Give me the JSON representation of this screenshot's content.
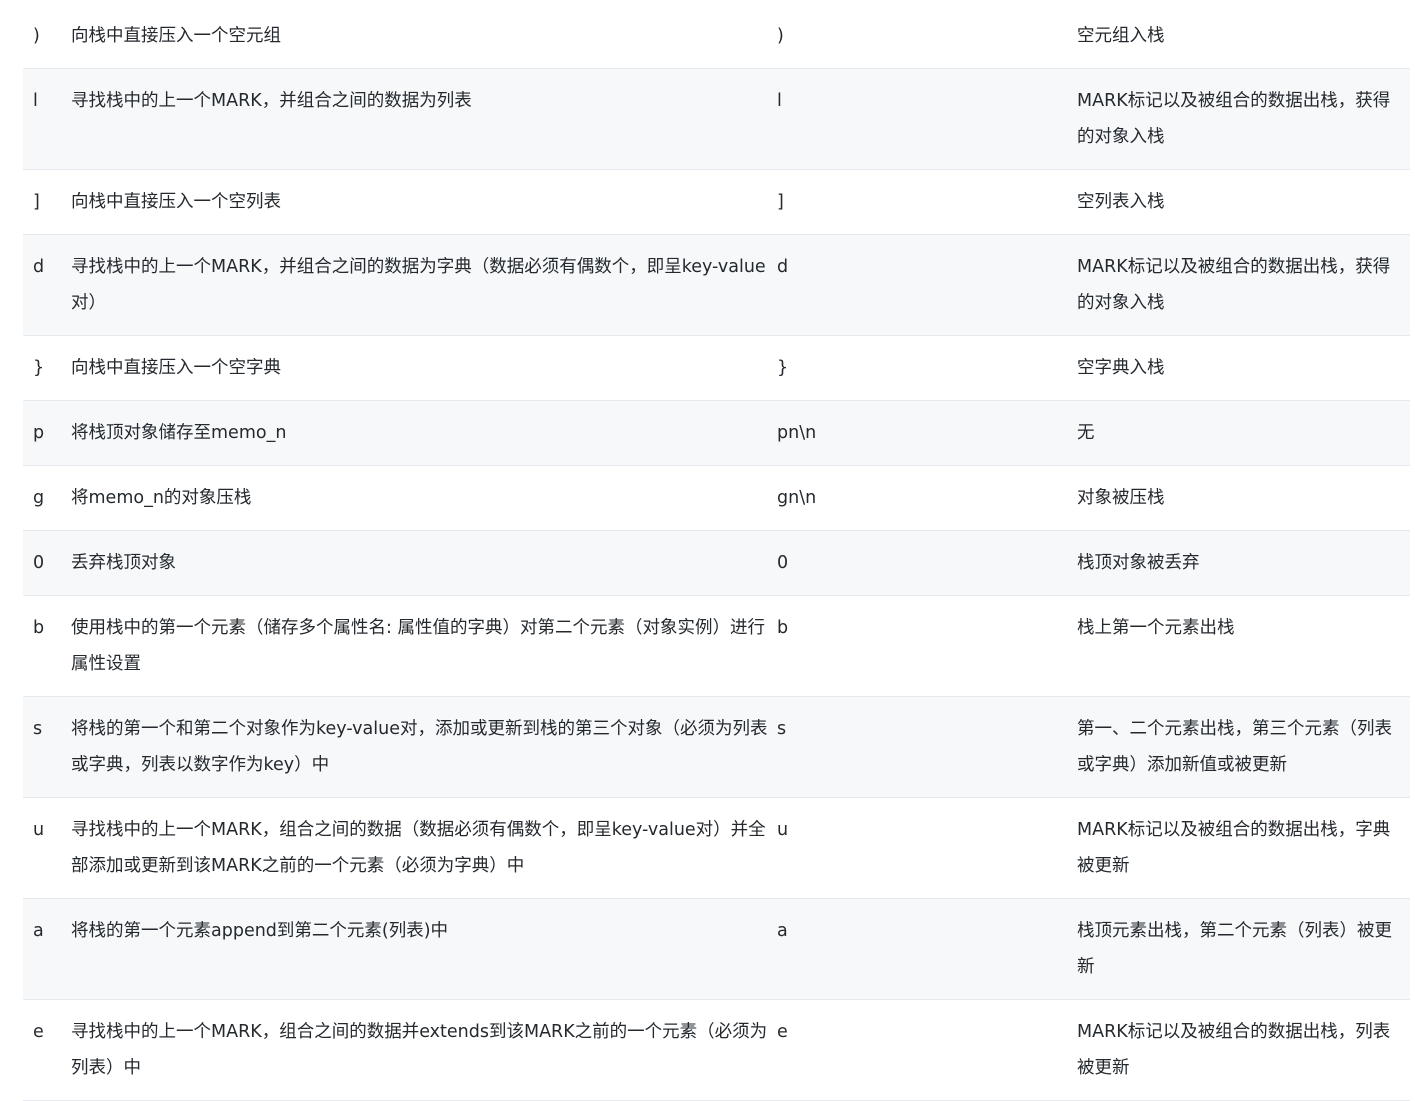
{
  "rows": [
    {
      "op": ")",
      "desc": "向栈中直接压入一个空元组",
      "example": ")",
      "effect": "空元组入栈"
    },
    {
      "op": "l",
      "desc": "寻找栈中的上一个MARK，并组合之间的数据为列表",
      "example": "l",
      "effect": "MARK标记以及被组合的数据出栈，获得的对象入栈"
    },
    {
      "op": "]",
      "desc": "向栈中直接压入一个空列表",
      "example": "]",
      "effect": "空列表入栈"
    },
    {
      "op": "d",
      "desc": "寻找栈中的上一个MARK，并组合之间的数据为字典（数据必须有偶数个，即呈key-value对）",
      "example": "d",
      "effect": "MARK标记以及被组合的数据出栈，获得的对象入栈"
    },
    {
      "op": "}",
      "desc": "向栈中直接压入一个空字典",
      "example": "}",
      "effect": "空字典入栈"
    },
    {
      "op": "p",
      "desc": "将栈顶对象储存至memo_n",
      "example": "pn\\n",
      "effect": "无"
    },
    {
      "op": "g",
      "desc": "将memo_n的对象压栈",
      "example": "gn\\n",
      "effect": "对象被压栈"
    },
    {
      "op": "0",
      "desc": "丢弃栈顶对象",
      "example": "0",
      "effect": "栈顶对象被丢弃"
    },
    {
      "op": "b",
      "desc": "使用栈中的第一个元素（储存多个属性名: 属性值的字典）对第二个元素（对象实例）进行属性设置",
      "example": "b",
      "effect": "栈上第一个元素出栈"
    },
    {
      "op": "s",
      "desc": "将栈的第一个和第二个对象作为key-value对，添加或更新到栈的第三个对象（必须为列表或字典，列表以数字作为key）中",
      "example": "s",
      "effect": "第一、二个元素出栈，第三个元素（列表或字典）添加新值或被更新"
    },
    {
      "op": "u",
      "desc": "寻找栈中的上一个MARK，组合之间的数据（数据必须有偶数个，即呈key-value对）并全部添加或更新到该MARK之前的一个元素（必须为字典）中",
      "example": "u",
      "effect": "MARK标记以及被组合的数据出栈，字典被更新"
    },
    {
      "op": "a",
      "desc": "将栈的第一个元素append到第二个元素(列表)中",
      "example": "a",
      "effect": "栈顶元素出栈，第二个元素（列表）被更新"
    },
    {
      "op": "e",
      "desc": "寻找栈中的上一个MARK，组合之间的数据并extends到该MARK之前的一个元素（必须为列表）中",
      "example": "e",
      "effect": "MARK标记以及被组合的数据出栈，列表被更新"
    }
  ]
}
